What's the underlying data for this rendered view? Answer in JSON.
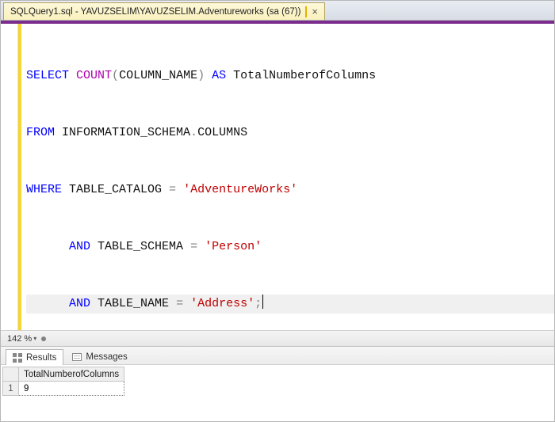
{
  "tab": {
    "title": "SQLQuery1.sql - YAVUZSELIM\\YAVUZSELIM.Adventureworks (sa (67))"
  },
  "sql": {
    "l1": {
      "select": "SELECT",
      "count": "COUNT",
      "lp": "(",
      "col": "COLUMN_NAME",
      "rp": ")",
      "as": " AS ",
      "alias": "TotalNumberofColumns"
    },
    "l2": {
      "from": "FROM",
      "schema": " INFORMATION_SCHEMA",
      "dot": ".",
      "obj": "COLUMNS"
    },
    "l3": {
      "where": "WHERE",
      "col": " TABLE_CATALOG ",
      "eq": "= ",
      "val": "'AdventureWorks'"
    },
    "l4": {
      "and": "AND",
      "col": " TABLE_SCHEMA ",
      "eq": "= ",
      "val": "'Person'"
    },
    "l5": {
      "and": "AND",
      "col": " TABLE_NAME ",
      "eq": "= ",
      "val": "'Address'",
      "semi": ";"
    }
  },
  "zoom": {
    "value": "142 %"
  },
  "resultTabs": {
    "results": "Results",
    "messages": "Messages"
  },
  "resultGrid": {
    "colHeader": "TotalNumberofColumns",
    "rowNumber": "1",
    "cellValue": "9"
  }
}
